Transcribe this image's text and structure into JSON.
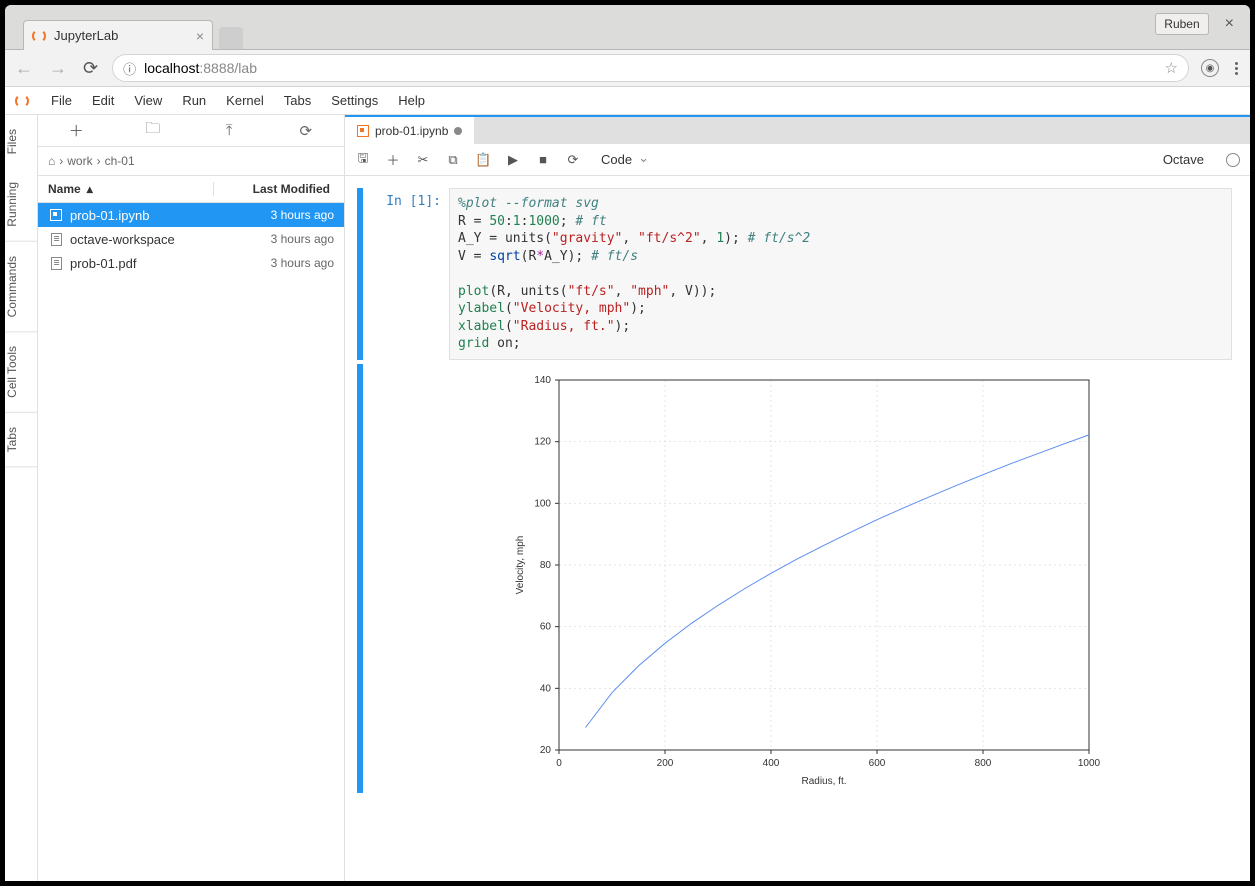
{
  "window": {
    "user": "Ruben"
  },
  "browser_tab": {
    "title": "JupyterLab"
  },
  "url": {
    "host": "localhost",
    "rest": ":8888/lab"
  },
  "menu": [
    "File",
    "Edit",
    "View",
    "Run",
    "Kernel",
    "Tabs",
    "Settings",
    "Help"
  ],
  "vtabs": [
    "Files",
    "Running",
    "Commands",
    "Cell Tools",
    "Tabs"
  ],
  "breadcrumb": [
    "work",
    "ch-01"
  ],
  "file_header": {
    "name": "Name",
    "modified": "Last Modified"
  },
  "files": [
    {
      "name": "prob-01.ipynb",
      "modified": "3 hours ago",
      "type": "notebook",
      "selected": true
    },
    {
      "name": "octave-workspace",
      "modified": "3 hours ago",
      "type": "file",
      "selected": false
    },
    {
      "name": "prob-01.pdf",
      "modified": "3 hours ago",
      "type": "file",
      "selected": false
    }
  ],
  "doc_tab": {
    "name": "prob-01.ipynb",
    "dirty": true
  },
  "cell_type": "Code",
  "kernel": "Octave",
  "prompt": "In [1]:",
  "code_tokens": [
    [
      {
        "t": "%plot --format svg",
        "c": "c-comment"
      }
    ],
    [
      {
        "t": "R = "
      },
      {
        "t": "50",
        "c": "c-num"
      },
      {
        "t": ":"
      },
      {
        "t": "1",
        "c": "c-num"
      },
      {
        "t": ":"
      },
      {
        "t": "1000",
        "c": "c-num"
      },
      {
        "t": "; "
      },
      {
        "t": "# ft",
        "c": "c-comment"
      }
    ],
    [
      {
        "t": "A_Y = units("
      },
      {
        "t": "\"gravity\"",
        "c": "c-str"
      },
      {
        "t": ", "
      },
      {
        "t": "\"ft/s^2\"",
        "c": "c-str"
      },
      {
        "t": ", "
      },
      {
        "t": "1",
        "c": "c-num"
      },
      {
        "t": "); "
      },
      {
        "t": "# ft/s^2",
        "c": "c-comment"
      }
    ],
    [
      {
        "t": "V = "
      },
      {
        "t": "sqrt",
        "c": "c-fn"
      },
      {
        "t": "(R"
      },
      {
        "t": "*",
        "c": "c-op"
      },
      {
        "t": "A_Y); "
      },
      {
        "t": "# ft/s",
        "c": "c-comment"
      }
    ],
    [
      {
        "t": ""
      }
    ],
    [
      {
        "t": "plot",
        "c": "c-kw"
      },
      {
        "t": "(R, units("
      },
      {
        "t": "\"ft/s\"",
        "c": "c-str"
      },
      {
        "t": ", "
      },
      {
        "t": "\"mph\"",
        "c": "c-str"
      },
      {
        "t": ", V));"
      }
    ],
    [
      {
        "t": "ylabel",
        "c": "c-kw"
      },
      {
        "t": "("
      },
      {
        "t": "\"Velocity, mph\"",
        "c": "c-str"
      },
      {
        "t": ");"
      }
    ],
    [
      {
        "t": "xlabel",
        "c": "c-kw"
      },
      {
        "t": "("
      },
      {
        "t": "\"Radius, ft.\"",
        "c": "c-str"
      },
      {
        "t": ");"
      }
    ],
    [
      {
        "t": "grid",
        "c": "c-kw"
      },
      {
        "t": " on;"
      }
    ]
  ],
  "chart_data": {
    "type": "line",
    "title": "",
    "xlabel": "Radius, ft.",
    "ylabel": "Velocity, mph",
    "xlim": [
      0,
      1000
    ],
    "ylim": [
      20,
      140
    ],
    "xticks": [
      0,
      200,
      400,
      600,
      800,
      1000
    ],
    "yticks": [
      20,
      40,
      60,
      80,
      100,
      120,
      140
    ],
    "x": [
      50,
      100,
      150,
      200,
      250,
      300,
      350,
      400,
      450,
      500,
      550,
      600,
      650,
      700,
      750,
      800,
      850,
      900,
      950,
      1000
    ],
    "y": [
      27.3,
      38.6,
      47.3,
      54.6,
      61.1,
      66.9,
      72.3,
      77.3,
      82.0,
      86.4,
      90.6,
      94.7,
      98.5,
      102.2,
      105.8,
      109.3,
      112.7,
      115.9,
      119.1,
      122.2
    ],
    "grid": true,
    "color": "#5b8def"
  }
}
